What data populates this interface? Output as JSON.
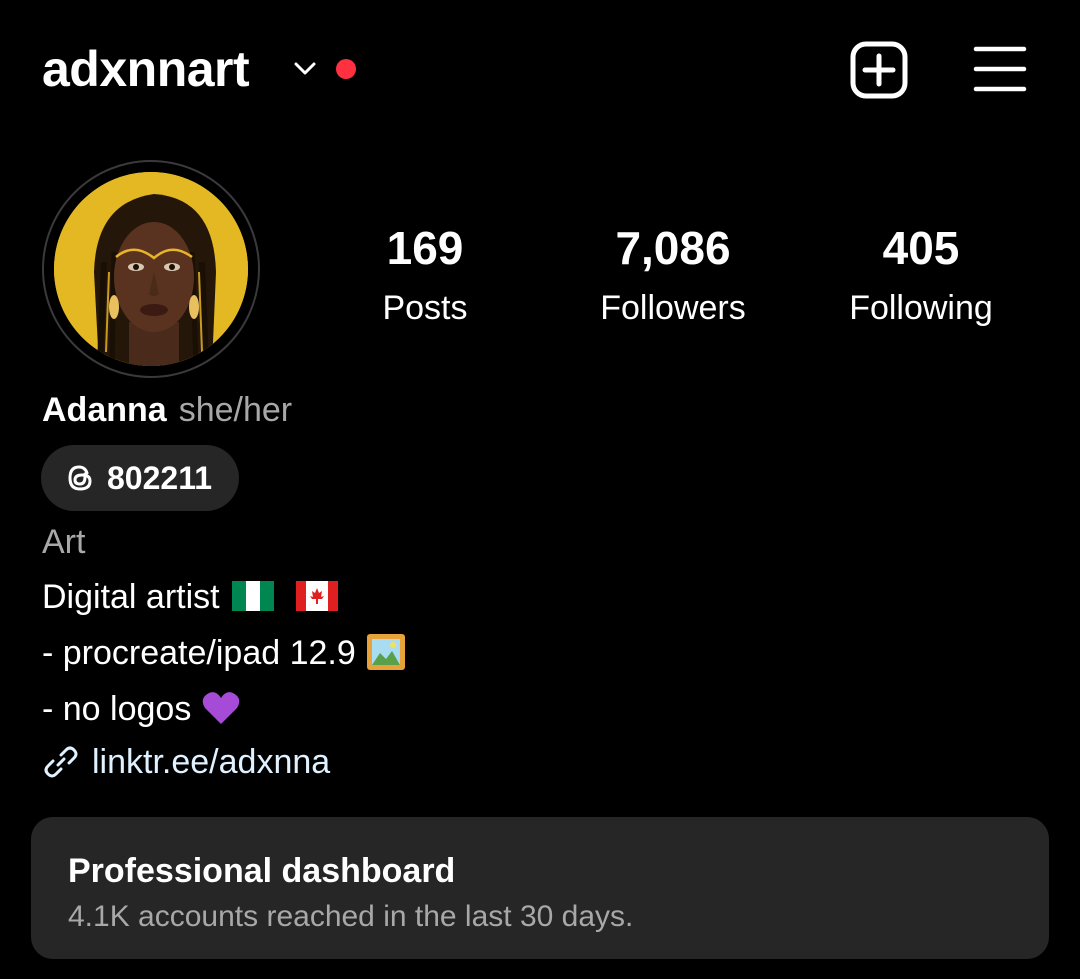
{
  "header": {
    "username": "adxnnart",
    "chevron_icon": "chevron-down-icon",
    "new_post_icon": "plus-square-icon",
    "menu_icon": "hamburger-menu-icon",
    "notification_dot_color": "#ff3040"
  },
  "profile": {
    "avatar_icon": "profile-avatar",
    "stats": [
      {
        "value": "169",
        "label": "Posts"
      },
      {
        "value": "7,086",
        "label": "Followers"
      },
      {
        "value": "405",
        "label": "Following"
      }
    ],
    "name": "Adanna",
    "pronouns": "she/her",
    "threads_badge": {
      "icon": "threads-icon",
      "text": "802211"
    },
    "category": "Art",
    "bio": {
      "line1": "Digital artist",
      "line1_emojis": [
        "flag-nigeria",
        "flag-canada"
      ],
      "line2": "- procreate/ipad 12.9",
      "line2_emoji": "framed-picture",
      "line3": "- no logos",
      "line3_emoji": "purple-heart"
    },
    "link": {
      "icon": "link-icon",
      "text": "linktr.ee/adxnna"
    }
  },
  "dashboard": {
    "title": "Professional dashboard",
    "subtitle": "4.1K accounts reached in the last 30 days."
  },
  "colors": {
    "background": "#000000",
    "card": "#262626",
    "secondary_text": "#a8a8a8",
    "link_text": "#e0f1ff",
    "avatar_bg": "#e3b823"
  }
}
